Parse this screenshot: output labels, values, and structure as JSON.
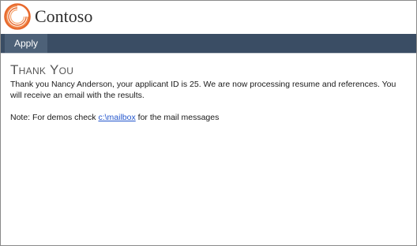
{
  "brand": {
    "name": "Contoso",
    "logo_icon": "contoso-swirl-logo",
    "logo_color": "#e8692d"
  },
  "nav": {
    "items": [
      {
        "label": "Apply"
      }
    ],
    "bar_color": "#3a4d64",
    "active_color": "#4d6178"
  },
  "main": {
    "title": "Thank You",
    "message": "Thank you Nancy Anderson, your applicant ID is 25. We are now processing resume and references. You will receive an email with the results.",
    "note": {
      "prefix": "Note: For demos check ",
      "link_text": "c:\\mailbox",
      "suffix": " for the mail messages"
    }
  }
}
